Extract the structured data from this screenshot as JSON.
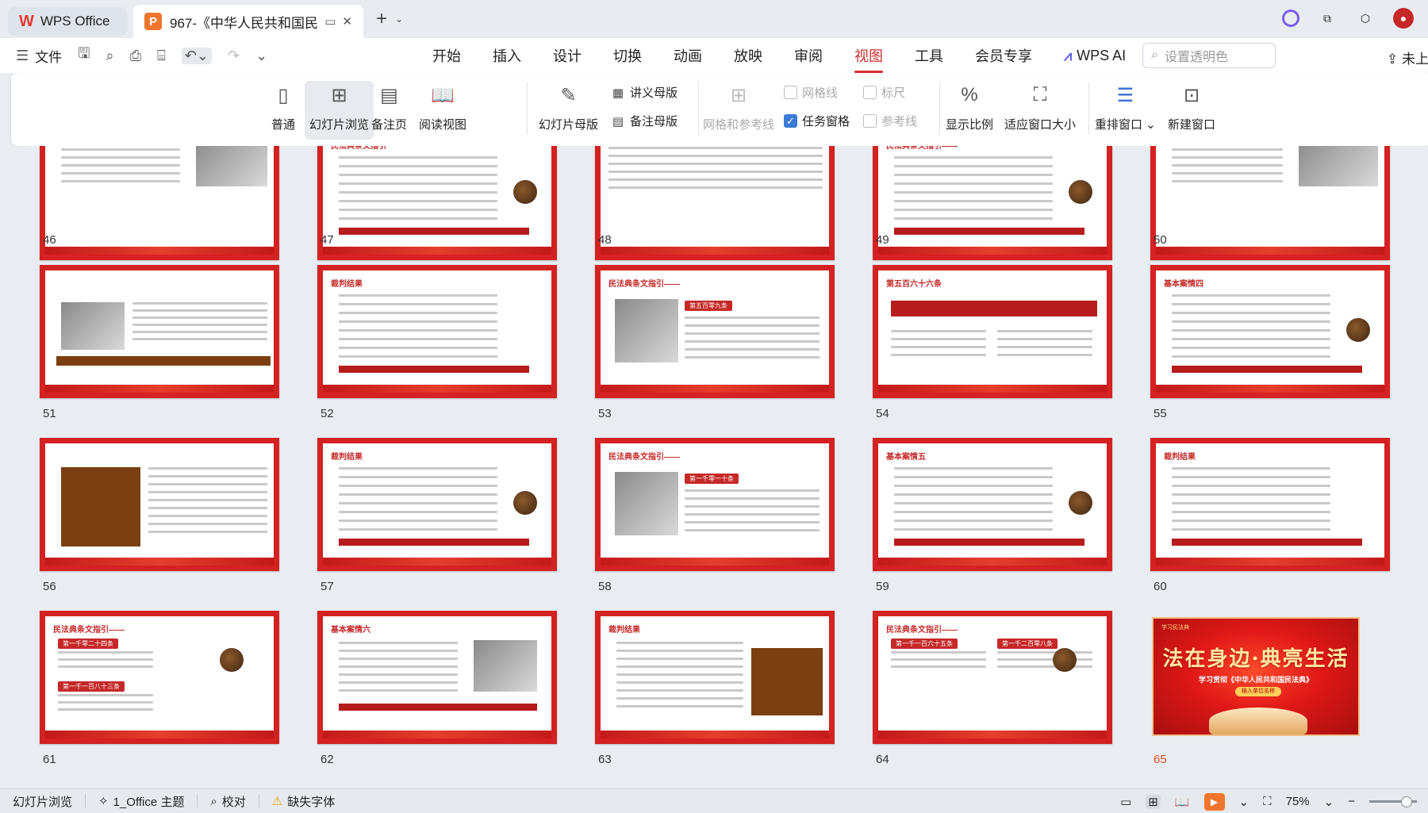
{
  "titlebar": {
    "wps_tab": "WPS Office",
    "doc_tab": "967-《中华人民共和国民法典",
    "doc_icon": "P"
  },
  "quick_access": {
    "file": "文件"
  },
  "menu_tabs": [
    "开始",
    "插入",
    "设计",
    "切换",
    "动画",
    "放映",
    "审阅",
    "视图",
    "工具",
    "会员专享"
  ],
  "active_tab": "视图",
  "wps_ai": "WPS AI",
  "search": {
    "placeholder": "设置透明色"
  },
  "upload": "未上",
  "ribbon": {
    "normal": "普通",
    "slide_sorter": "幻灯片浏览",
    "notes_page": "备注页",
    "reading_view": "阅读视图",
    "slide_master": "幻灯片母版",
    "handout_master": "讲义母版",
    "notes_master": "备注母版",
    "grid_guides": "网格和参考线",
    "gridlines": "网格线",
    "ruler": "标尺",
    "task_pane": "任务窗格",
    "guides": "参考线",
    "zoom": "显示比例",
    "fit_window": "适应窗口大小",
    "arrange_windows": "重排窗口",
    "new_window": "新建窗口"
  },
  "slides": [
    {
      "n": "46"
    },
    {
      "n": "47"
    },
    {
      "n": "48"
    },
    {
      "n": "49"
    },
    {
      "n": "50"
    },
    {
      "n": "51"
    },
    {
      "n": "52"
    },
    {
      "n": "53"
    },
    {
      "n": "54"
    },
    {
      "n": "55"
    },
    {
      "n": "56"
    },
    {
      "n": "57"
    },
    {
      "n": "58"
    },
    {
      "n": "59"
    },
    {
      "n": "60"
    },
    {
      "n": "61"
    },
    {
      "n": "62"
    },
    {
      "n": "63"
    },
    {
      "n": "64"
    },
    {
      "n": "65"
    }
  ],
  "slide_texts": {
    "s47": "民法典条文指引",
    "s49": "民法典条文指引——",
    "s52": "裁判结果",
    "s53": "民法典条文指引——",
    "s53b": "第五百零九条",
    "s54": "第五百六十六条",
    "s55": "基本案情四",
    "s57": "裁判结果",
    "s58": "民法典条文指引——",
    "s58b": "第一千零一十条",
    "s59": "基本案情五",
    "s60": "裁判结果",
    "s61": "民法典条文指引——",
    "s61b": "第一千零二十四条",
    "s61c": "第一千一百八十三条",
    "s62": "基本案情六",
    "s63": "裁判结果",
    "s64": "民法典条文指引——",
    "s64b": "第一千一百六十五条",
    "s64c": "第一千二百零八条"
  },
  "final_slide": {
    "tag": "学习民法典",
    "title": "法在身边·典亮生活",
    "subtitle": "学习贯彻《中华人民共和国民法典》",
    "button": "输入单位名称"
  },
  "status": {
    "view": "幻灯片浏览",
    "theme": "1_Office 主题",
    "proof": "校对",
    "missing_fonts": "缺失字体",
    "zoom": "75%"
  },
  "colors": {
    "accent": "#d32f2f",
    "slide_border": "#d42121",
    "current_number": "#d9541e"
  }
}
